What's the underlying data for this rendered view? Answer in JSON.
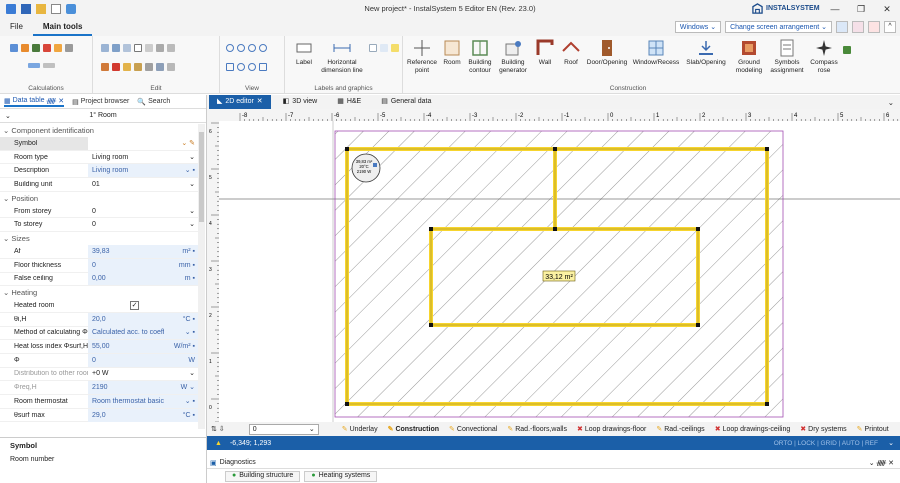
{
  "window": {
    "title": "New project* - InstalSystem 5 Editor EN (Rev. 23.0)",
    "brand": "INSTALSYSTEM"
  },
  "menu": {
    "file": "File",
    "main_tools": "Main tools",
    "windows_dd": "Windows",
    "screen_dd": "Change screen arrangement"
  },
  "ribbon": {
    "groups": {
      "calculations": "Calculations",
      "edit": "Edit",
      "view": "View",
      "labels": "Labels and graphics",
      "construction": "Construction"
    },
    "buttons": {
      "label": "Label",
      "hdim": "Horizontal dimension line",
      "refpoint": "Reference point",
      "room": "Room",
      "bcontour": "Building contour",
      "bgen": "Building generator",
      "wall": "Wall",
      "roof": "Roof",
      "door": "Door/Opening",
      "window": "Window/Recess",
      "slab": "Slab/Opening",
      "ground": "Ground modeling",
      "symbols": "Symbols assignment",
      "compass": "Compass rose"
    }
  },
  "leftpanel": {
    "tabs": [
      "Data table",
      "Project browser",
      "Search"
    ],
    "room_title": "1° Room",
    "sections": {
      "identification": "Component identification",
      "position": "Position",
      "sizes": "Sizes",
      "heating": "Heating"
    },
    "rows": {
      "symbol": {
        "k": "Symbol",
        "v": ""
      },
      "room_type": {
        "k": "Room type",
        "v": "Living room"
      },
      "description": {
        "k": "Description",
        "v": "Living room"
      },
      "building_unit": {
        "k": "Building unit",
        "v": "01"
      },
      "from_storey": {
        "k": "From storey",
        "v": "0"
      },
      "to_storey": {
        "k": "To storey",
        "v": "0"
      },
      "af": {
        "k": "Af",
        "v": "39,83",
        "u": "m²"
      },
      "floor_thick": {
        "k": "Floor thickness",
        "v": "0",
        "u": "mm"
      },
      "false_ceiling": {
        "k": "False ceiling",
        "v": "0,00",
        "u": "m"
      },
      "heated": {
        "k": "Heated room",
        "v": "✓"
      },
      "theta": {
        "k": "θi,H",
        "v": "20,0",
        "u": "°C"
      },
      "method": {
        "k": "Method of calculating Φi",
        "v": "Calculated acc. to coeffi"
      },
      "heatloss": {
        "k": "Heat loss index Φsurf,H",
        "v": "55,00",
        "u": "W/m²"
      },
      "phi": {
        "k": "Φ",
        "v": "0",
        "u": "W"
      },
      "distribution": {
        "k": "Distribution to other room",
        "v": "+0 W"
      },
      "phireq": {
        "k": "Φreq,H",
        "v": "2190",
        "u": "W"
      },
      "thermostat": {
        "k": "Room thermostat",
        "v": "Room thermostat basic"
      },
      "surfmax": {
        "k": "θsurf max",
        "v": "29,0",
        "u": "°C"
      }
    },
    "help": {
      "title": "Symbol",
      "desc": "Room number"
    }
  },
  "doctabs": [
    "2D editor",
    "3D view",
    "H&E",
    "General data"
  ],
  "canvas": {
    "ruler": [
      "-8",
      "-7",
      "-6",
      "-5",
      "-4",
      "-3",
      "-2",
      "-1",
      "0",
      "1",
      "2",
      "3",
      "4",
      "5",
      "6"
    ],
    "vruler": [
      "6",
      "5",
      "4",
      "3",
      "2",
      "1",
      "0"
    ],
    "room_label": "33,12 m²",
    "room_bubble": [
      "39,83 m²",
      "20°C",
      "2190 W"
    ]
  },
  "status": {
    "zoom": "0",
    "layers": [
      "Underlay",
      "Construction",
      "Convectional",
      "Rad.-floors,walls",
      "Loop drawings-floor",
      "Rad.-ceilings",
      "Loop drawings-ceiling",
      "Dry systems",
      "Printout"
    ]
  },
  "coords": {
    "value": "-6,349; 1,293",
    "flags": "ORTO | LOCK | GRID | AUTO | REF"
  },
  "diagnostics": {
    "title": "Diagnostics"
  },
  "bottom_tabs": [
    "Building structure",
    "Heating systems"
  ],
  "colors": {
    "accent": "#1b5fa8",
    "wall": "#f7d52e",
    "room_border": "#a24fb2"
  }
}
